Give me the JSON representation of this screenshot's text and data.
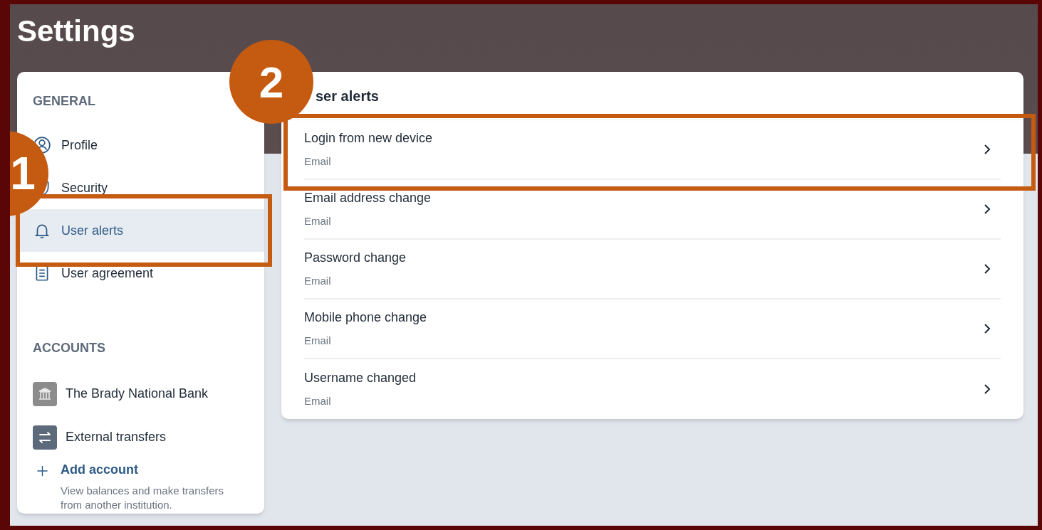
{
  "header": {
    "title": "Settings"
  },
  "sidebar": {
    "general": {
      "heading": "GENERAL",
      "items": [
        {
          "label": "Profile",
          "selected": false
        },
        {
          "label": "Security",
          "selected": false
        },
        {
          "label": "User alerts",
          "selected": true
        },
        {
          "label": "User agreement",
          "selected": false
        }
      ]
    },
    "accounts": {
      "heading": "ACCOUNTS",
      "items": [
        {
          "label": "The Brady National Bank"
        },
        {
          "label": "External transfers"
        }
      ],
      "add_account": {
        "label": "Add account",
        "description": "View balances and make transfers from another institution."
      }
    }
  },
  "main": {
    "title": "ser alerts",
    "rows": [
      {
        "title": "Login from new device",
        "subtitle": "Email"
      },
      {
        "title": "Email address change",
        "subtitle": "Email"
      },
      {
        "title": "Password change",
        "subtitle": "Email"
      },
      {
        "title": "Mobile phone change",
        "subtitle": "Email"
      },
      {
        "title": "Username changed",
        "subtitle": "Email"
      }
    ]
  },
  "annotations": [
    {
      "label": "1"
    },
    {
      "label": "2"
    }
  ]
}
